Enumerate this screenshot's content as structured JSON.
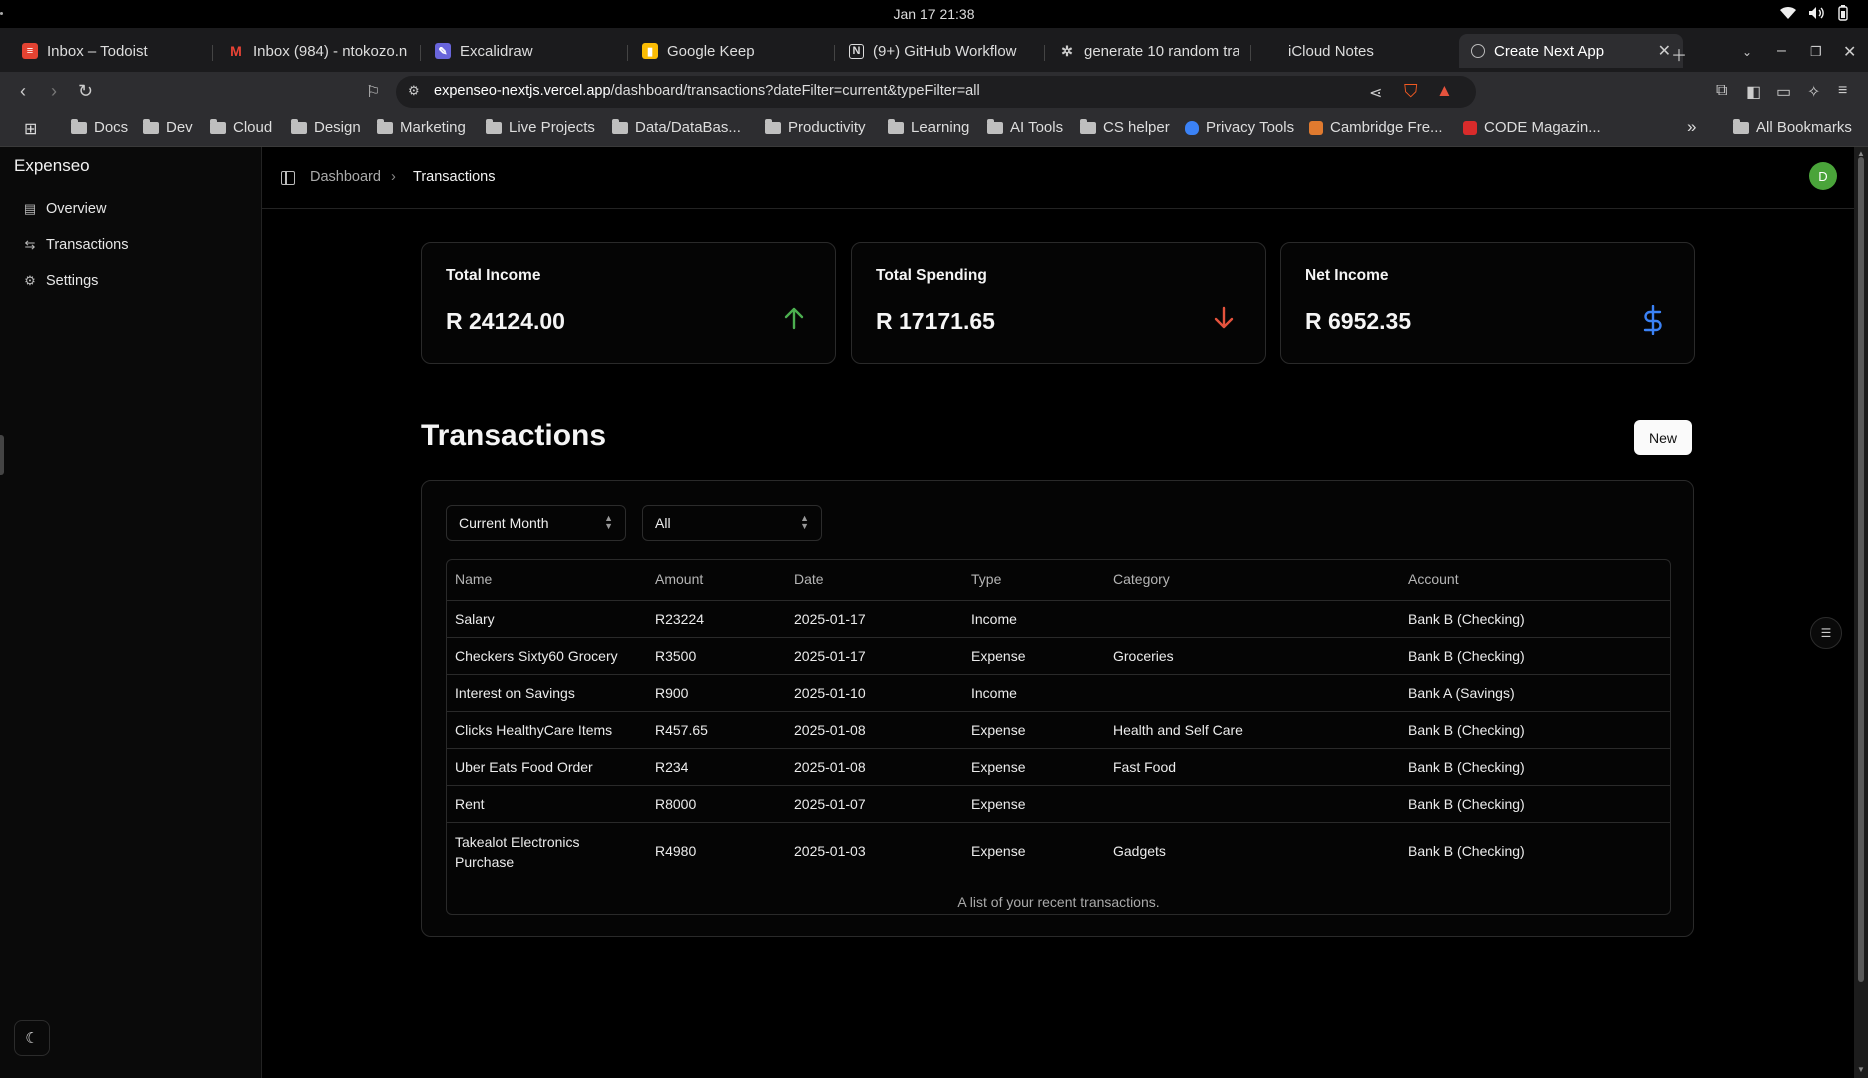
{
  "os": {
    "clock": "Jan 17  21:38"
  },
  "browser": {
    "tabs": [
      {
        "label": "Inbox – Todoist",
        "icon": "todoist-icon",
        "color": "#e44332"
      },
      {
        "label": "Inbox (984) - ntokozo.n",
        "icon": "gmail-icon",
        "color": "#ea4335"
      },
      {
        "label": "Excalidraw",
        "icon": "excalidraw-icon",
        "color": "#6965db"
      },
      {
        "label": "Google Keep",
        "icon": "keep-icon",
        "color": "#fbbc04"
      },
      {
        "label": "(9+) GitHub Workflow",
        "icon": "notion-icon",
        "color": "#ffffff"
      },
      {
        "label": "generate 10 random tra",
        "icon": "chatgpt-icon",
        "color": "#cccccc"
      },
      {
        "label": "iCloud Notes",
        "icon": "apple-icon",
        "color": "#cccccc"
      },
      {
        "label": "Create Next App",
        "icon": "globe-icon",
        "color": "#bbbbbb"
      }
    ],
    "url_host": "expenseo-nextjs.vercel.app",
    "url_path": "/dashboard/transactions?dateFilter=current&typeFilter=all",
    "bookmarks": [
      {
        "label": "Docs",
        "type": "folder"
      },
      {
        "label": "Dev",
        "type": "folder"
      },
      {
        "label": "Cloud",
        "type": "folder"
      },
      {
        "label": "Design",
        "type": "folder"
      },
      {
        "label": "Marketing",
        "type": "folder"
      },
      {
        "label": "Live Projects",
        "type": "folder"
      },
      {
        "label": "Data/DataBas...",
        "type": "folder"
      },
      {
        "label": "Productivity",
        "type": "folder"
      },
      {
        "label": "Learning",
        "type": "folder"
      },
      {
        "label": "AI Tools",
        "type": "folder"
      },
      {
        "label": "CS helper",
        "type": "folder"
      },
      {
        "label": "Privacy Tools",
        "type": "site",
        "color": "#3b82f6"
      },
      {
        "label": "Cambridge Fre...",
        "type": "site",
        "color": "#e07a2f"
      },
      {
        "label": "CODE Magazin...",
        "type": "site",
        "color": "#d92b2b"
      }
    ],
    "all_bookmarks": "All Bookmarks",
    "overflow": "»"
  },
  "app": {
    "brand": "Expenseo",
    "nav": [
      {
        "label": "Overview",
        "icon": "overview-icon"
      },
      {
        "label": "Transactions",
        "icon": "transactions-icon"
      },
      {
        "label": "Settings",
        "icon": "settings-icon"
      }
    ],
    "breadcrumb": {
      "parent": "Dashboard",
      "sep": "›",
      "current": "Transactions"
    },
    "avatar_initial": "D",
    "cards": [
      {
        "title": "Total Income",
        "value": "R 24124.00",
        "icon": "arrow-up-icon",
        "color": "#4caf50"
      },
      {
        "title": "Total Spending",
        "value": "R 17171.65",
        "icon": "arrow-down-icon",
        "color": "#e5533d"
      },
      {
        "title": "Net Income",
        "value": "R 6952.35",
        "icon": "dollar-icon",
        "color": "#3b82f6"
      }
    ],
    "section_title": "Transactions",
    "new_label": "New",
    "filters": {
      "date": "Current Month",
      "type": "All"
    },
    "table": {
      "columns": [
        "Name",
        "Amount",
        "Date",
        "Type",
        "Category",
        "Account"
      ],
      "rows": [
        [
          "Salary",
          "R23224",
          "2025-01-17",
          "Income",
          "",
          "Bank B (Checking)"
        ],
        [
          "Checkers Sixty60 Grocery",
          "R3500",
          "2025-01-17",
          "Expense",
          "Groceries",
          "Bank B (Checking)"
        ],
        [
          "Interest on Savings",
          "R900",
          "2025-01-10",
          "Income",
          "",
          "Bank A (Savings)"
        ],
        [
          "Clicks HealthyCare Items",
          "R457.65",
          "2025-01-08",
          "Expense",
          "Health and Self Care",
          "Bank B (Checking)"
        ],
        [
          "Uber Eats Food Order",
          "R234",
          "2025-01-08",
          "Expense",
          "Fast Food",
          "Bank B (Checking)"
        ],
        [
          "Rent",
          "R8000",
          "2025-01-07",
          "Expense",
          "",
          "Bank B (Checking)"
        ],
        [
          "Takealot Electronics Purchase",
          "R4980",
          "2025-01-03",
          "Expense",
          "Gadgets",
          "Bank B (Checking)"
        ]
      ],
      "caption": "A list of your recent transactions."
    }
  }
}
